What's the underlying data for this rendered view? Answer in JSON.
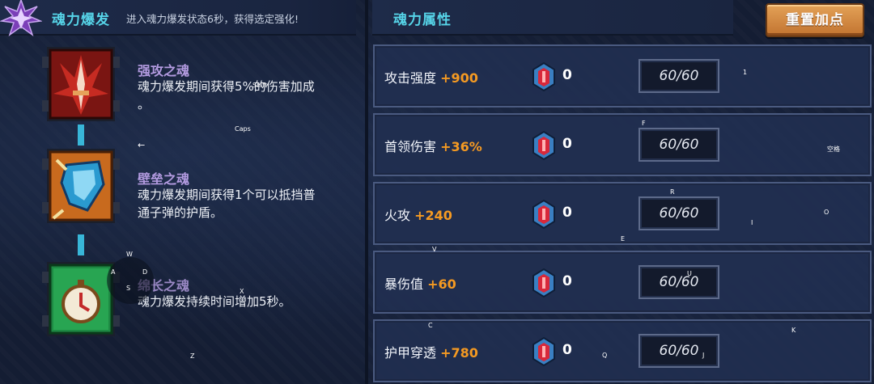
{
  "left_panel": {
    "title": "魂力爆发",
    "description": "进入魂力爆发状态6秒，获得选定强化!",
    "skills": [
      {
        "name": "强攻之魂",
        "line1": "魂力爆发期间获得5%的伤害加成",
        "line2": "。",
        "icon": "sword-soul-icon"
      },
      {
        "name": "壁垒之魂",
        "line1": "魂力爆发期间获得1个可以抵挡普",
        "line2": "通子弹的护盾。",
        "icon": "shield-soul-icon"
      },
      {
        "name": "绵长之魂",
        "line1": "魂力爆发持续时间增加5秒。",
        "line2": "",
        "icon": "clock-soul-icon"
      }
    ]
  },
  "right_panel": {
    "title": "魂力属性",
    "reset_button": "重置加点",
    "attributes": [
      {
        "label": "攻击强度",
        "bonus": "+900",
        "count": "0",
        "value": "60/60"
      },
      {
        "label": "首领伤害",
        "bonus": "+36%",
        "count": "0",
        "value": "60/60"
      },
      {
        "label": "火攻",
        "bonus": "+240",
        "count": "0",
        "value": "60/60"
      },
      {
        "label": "暴伤值",
        "bonus": "+60",
        "count": "0",
        "value": "60/60"
      },
      {
        "label": "护甲穿透",
        "bonus": "+780",
        "count": "0",
        "value": "60/60"
      }
    ]
  },
  "key_hints": {
    "shift": "Shift",
    "caps": "Caps",
    "left_arrow": "←",
    "w": "W",
    "a": "A",
    "s": "S",
    "d": "D",
    "x": "X",
    "z": "Z",
    "one": "1",
    "f": "F",
    "space": "空格",
    "r": "R",
    "o": "O",
    "i": "I",
    "e": "E",
    "v": "V",
    "u": "U",
    "c": "C",
    "k": "K",
    "q": "Q",
    "j": "J"
  },
  "colors": {
    "accent_title": "#56d4e8",
    "bonus": "#f59a22",
    "skill_name": "#b39be0",
    "reset_button": "#d98b3f"
  }
}
